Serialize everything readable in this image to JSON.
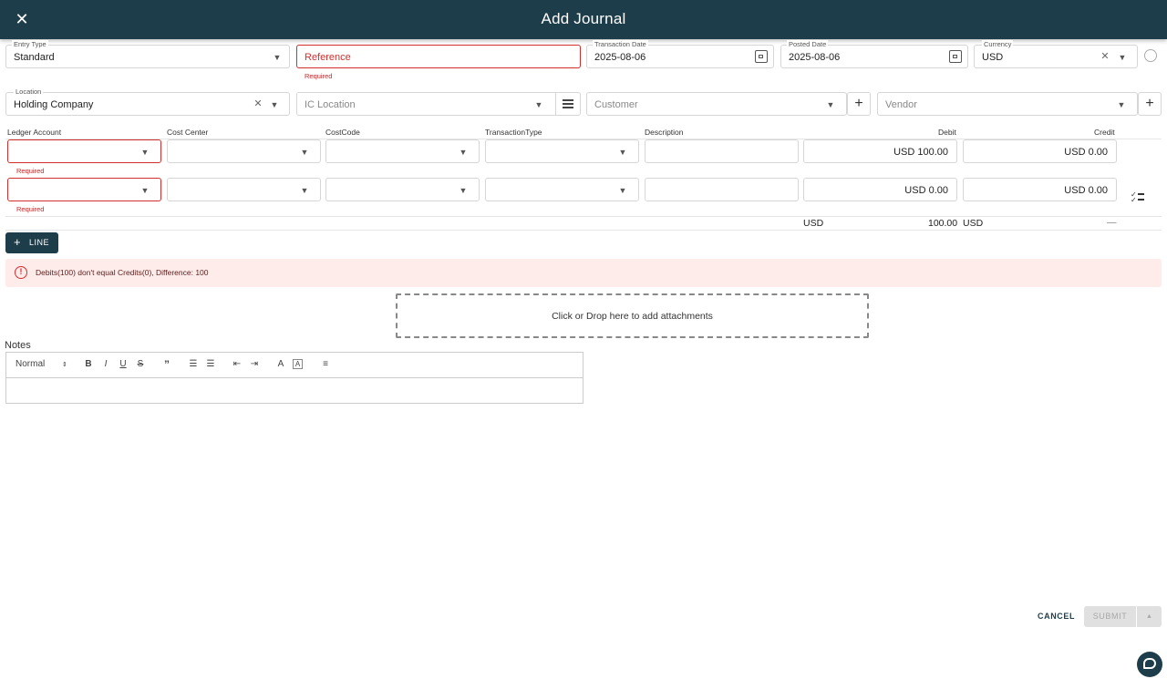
{
  "header": {
    "title": "Add Journal",
    "close_icon": "close-icon"
  },
  "row1": {
    "entry_type": {
      "label": "Entry Type",
      "value": "Standard"
    },
    "reference": {
      "placeholder": "Reference",
      "error": "Required"
    },
    "transaction_date": {
      "label": "Transaction Date",
      "value": "2025-08-06"
    },
    "posted_date": {
      "label": "Posted Date",
      "value": "2025-08-06"
    },
    "currency": {
      "label": "Currency",
      "value": "USD"
    }
  },
  "row2": {
    "location": {
      "label": "Location",
      "value": "Holding Company"
    },
    "ic_location": {
      "placeholder": "IC Location"
    },
    "customer": {
      "placeholder": "Customer"
    },
    "vendor": {
      "placeholder": "Vendor"
    }
  },
  "lines": {
    "columns": [
      "Ledger Account",
      "Cost Center",
      "CostCode",
      "TransactionType",
      "Description",
      "Debit",
      "Credit"
    ],
    "rows": [
      {
        "ledger_error": "Required",
        "debit": "USD 100.00",
        "credit": "USD 0.00"
      },
      {
        "ledger_error": "Required",
        "debit": "USD 0.00",
        "credit": "USD 0.00"
      }
    ],
    "totals": {
      "currency_left": "USD",
      "debit_total": "100.00",
      "currency_right": "USD",
      "credit_total": "—"
    },
    "add_line_label": "LINE"
  },
  "alert": {
    "message": "Debits(100) don't equal Credits(0), Difference: 100"
  },
  "attachments": {
    "text": "Click or Drop here to add attachments"
  },
  "notes": {
    "label": "Notes",
    "format": "Normal"
  },
  "footer": {
    "cancel": "CANCEL",
    "submit": "SUBMIT"
  },
  "colors": {
    "primary": "#1d3d4a",
    "error": "#d32f2f",
    "alert_bg": "#fdecea"
  }
}
